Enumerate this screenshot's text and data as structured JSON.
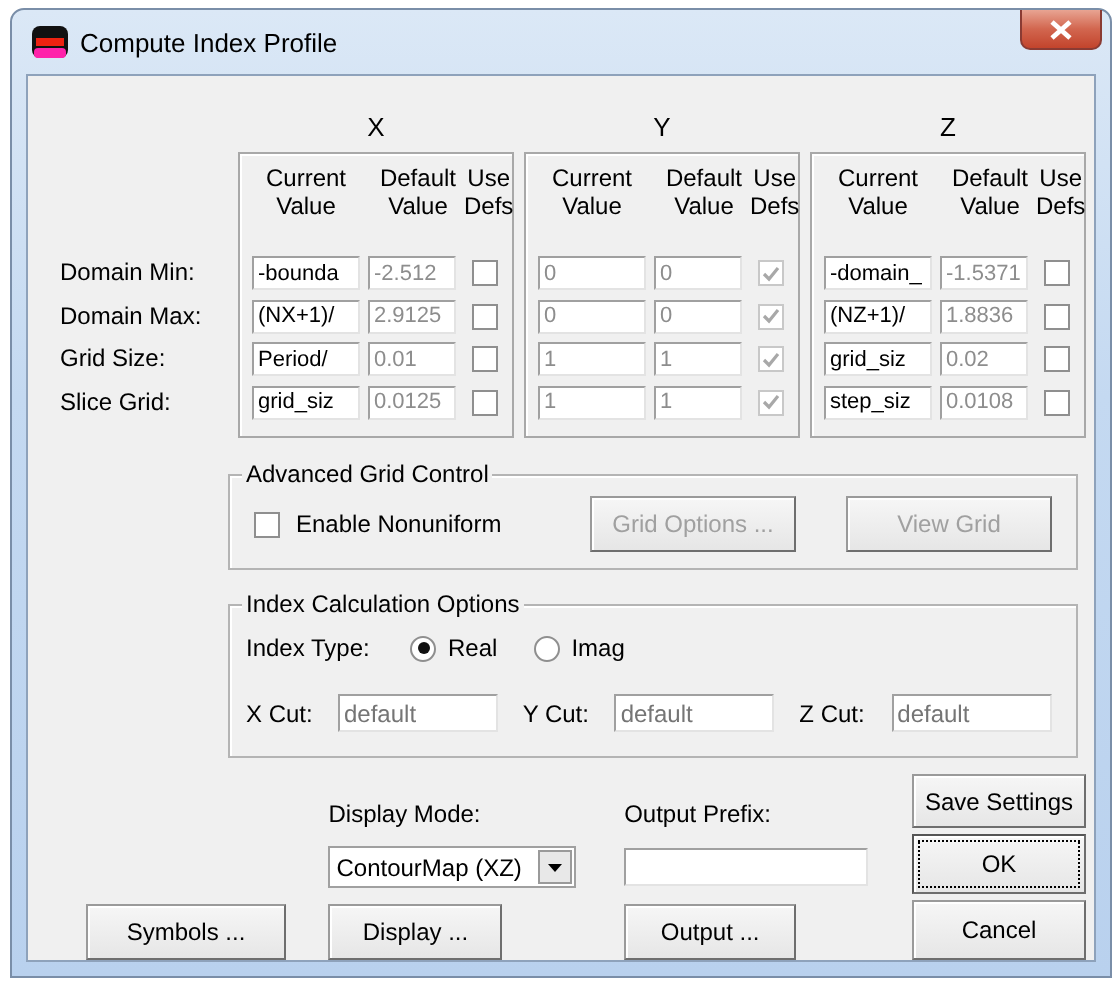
{
  "window": {
    "title": "Compute Index Profile"
  },
  "row_labels": [
    "Domain Min:",
    "Domain Max:",
    "Grid Size:",
    "Slice Grid:"
  ],
  "axes": [
    {
      "name": "X",
      "headers": [
        "Current Value",
        "Default Value",
        "Use Defs"
      ],
      "disabled": false,
      "rows": [
        {
          "current": "-bounda",
          "default": "-2.512",
          "use_defs": false
        },
        {
          "current": "(NX+1)/",
          "default": "2.9125",
          "use_defs": false
        },
        {
          "current": "Period/",
          "default": "0.01",
          "use_defs": false
        },
        {
          "current": "grid_siz",
          "default": "0.0125",
          "use_defs": false
        }
      ]
    },
    {
      "name": "Y",
      "headers": [
        "Current Value",
        "Default Value",
        "Use Defs"
      ],
      "disabled": true,
      "rows": [
        {
          "current": "0",
          "default": "0",
          "use_defs": true
        },
        {
          "current": "0",
          "default": "0",
          "use_defs": true
        },
        {
          "current": "1",
          "default": "1",
          "use_defs": true
        },
        {
          "current": "1",
          "default": "1",
          "use_defs": true
        }
      ]
    },
    {
      "name": "Z",
      "headers": [
        "Current Value",
        "Default Value",
        "Use Defs"
      ],
      "disabled": false,
      "rows": [
        {
          "current": "-domain_",
          "default": "-1.5371",
          "use_defs": false
        },
        {
          "current": "(NZ+1)/",
          "default": "1.8836",
          "use_defs": false
        },
        {
          "current": "grid_siz",
          "default": "0.02",
          "use_defs": false
        },
        {
          "current": "step_siz",
          "default": "0.0108",
          "use_defs": false
        }
      ]
    }
  ],
  "advanced_grid": {
    "title": "Advanced Grid Control",
    "enable_nonuniform": {
      "label": "Enable Nonuniform",
      "checked": false
    },
    "buttons": [
      {
        "label": "Grid Options ...",
        "disabled": true
      },
      {
        "label": "View Grid",
        "disabled": true
      }
    ]
  },
  "index_options": {
    "title": "Index Calculation Options",
    "index_type_label": "Index Type:",
    "index_types": [
      {
        "label": "Real",
        "selected": true
      },
      {
        "label": "Imag",
        "selected": false
      }
    ],
    "cuts": [
      {
        "label": "X Cut:",
        "placeholder": "default"
      },
      {
        "label": "Y Cut:",
        "placeholder": "default"
      },
      {
        "label": "Z Cut:",
        "placeholder": "default"
      }
    ]
  },
  "display_mode": {
    "label": "Display Mode:",
    "value": "ContourMap (XZ)"
  },
  "output_prefix": {
    "label": "Output Prefix:"
  },
  "symbols_button": "Symbols ...",
  "display_button": "Display ...",
  "output_button": "Output ...",
  "save_button": "Save Settings",
  "ok_button": {
    "label": "OK",
    "default": true
  },
  "cancel_button": "Cancel"
}
